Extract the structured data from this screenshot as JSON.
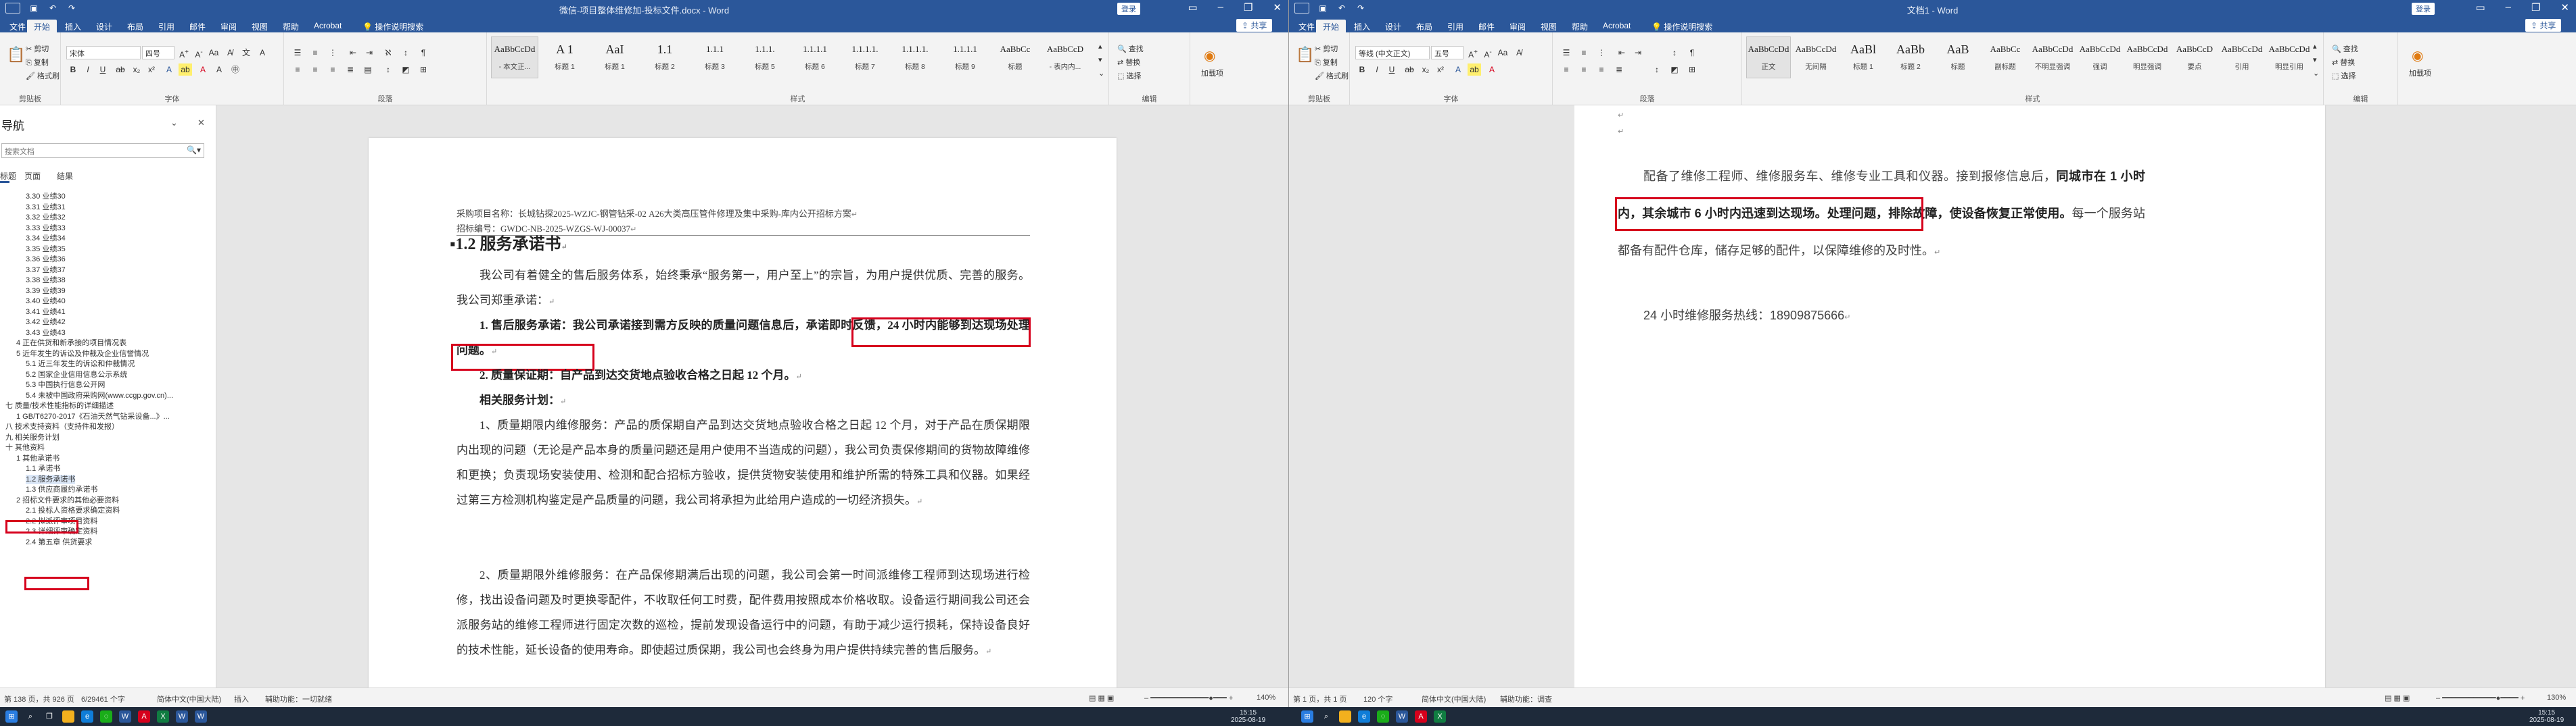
{
  "window_left": {
    "title": "微信-项目整体维修加-投标文件.docx - Word",
    "login": "登录",
    "ribbon_tabs": [
      "文件",
      "开始",
      "插入",
      "设计",
      "布局",
      "引用",
      "邮件",
      "审阅",
      "视图",
      "帮助",
      "Acrobat",
      "操作说明搜索"
    ],
    "share": "共享",
    "clipboard": {
      "cut": "剪切",
      "copy": "复制",
      "format_painter": "格式刷",
      "label": "剪贴板"
    },
    "font": {
      "name": "宋体",
      "size": "四号",
      "label": "字体"
    },
    "paragraph_label": "段落",
    "styles": [
      {
        "preview": "AaBbCcDd",
        "name": "- 本文正..."
      },
      {
        "preview": "A 1",
        "name": "标题 1"
      },
      {
        "preview": "AaI",
        "name": "标题 1"
      },
      {
        "preview": "1.1",
        "name": "标题 2"
      },
      {
        "preview": "1.1.1",
        "name": "标题 3"
      },
      {
        "preview": "1.1.1.",
        "name": "标题 5"
      },
      {
        "preview": "1.1.1.1",
        "name": "标题 6"
      },
      {
        "preview": "1.1.1.1.",
        "name": "标题 7"
      },
      {
        "preview": "1.1.1.1.",
        "name": "标题 8"
      },
      {
        "preview": "1.1.1.1",
        "name": "标题 9"
      },
      {
        "preview": "AaBbCc",
        "name": "标题"
      },
      {
        "preview": "AaBbCcD",
        "name": "- 表内内..."
      }
    ],
    "styles_label": "样式",
    "editing": {
      "find": "查找",
      "replace": "替换",
      "select": "选择",
      "label": "编辑"
    },
    "addin": "加载项",
    "nav": {
      "title": "导航",
      "search_placeholder": "搜索文档",
      "tabs": [
        "标题",
        "页面",
        "结果"
      ],
      "items": [
        "3.30 业绩30",
        "3.31 业绩31",
        "3.32 业绩32",
        "3.33 业绩33",
        "3.34 业绩34",
        "3.35 业绩35",
        "3.36 业绩36",
        "3.37 业绩37",
        "3.38 业绩38",
        "3.39 业绩39",
        "3.40 业绩40",
        "3.41 业绩41",
        "3.42 业绩42",
        "3.43 业绩43",
        "4 正在供货和新承接的项目情况表",
        "5 近年发生的诉讼及仲裁及企业信誉情况",
        "5.1 近三年发生的诉讼和仲裁情况",
        "5.2 国家企业信用信息公示系统",
        "5.3 中国执行信息公开网",
        "5.4 未被中国政府采购网(www.ccgp.gov.cn)...",
        "七 质量/技术性能指标的详细描述",
        "1 GB/T6270-2017《石油天然气钻采设备...》...",
        "八 技术支持资料（支持件和发报）",
        "九 相关服务计划",
        "十 其他资料",
        "1 其他承诺书",
        "1.1 承诺书",
        "1.2 服务承诺书",
        "1.3 供应商履约承诺书",
        "2 招标文件要求的其他必要资料",
        "2.1 投标人资格要求确定资料",
        "2.2 拟派评审项目资料",
        "2.3 详细评审确定资料",
        "2.4 第五章 供货要求"
      ]
    },
    "page": {
      "header_line1": "采购项目名称：长城钻探2025-WZJC-钢管钻采-02 A26大类高压管件修理及集中采购-库内公开招标方案",
      "header_line2": "招标编号：GWDC-NB-2025-WZGS-WJ-00037",
      "heading": "1.2 服务承诺书",
      "intro": "我公司有着健全的售后服务体系，始终秉承“服务第一，用户至上”的宗旨，为用户提供优质、完善的服务。我公司郑重承诺：",
      "item1_label": "1. 售后服务承诺：",
      "item1_text": "我公司承诺接到需方反映的质量问题信息后，",
      "item1_boxed": "承诺即时反馈，24 小时内能够到达现场处理问题。",
      "item2": "2. 质量保证期：自产品到达交货地点验收合格之日起 12 个月。",
      "related": "相关服务计划：",
      "p1": "1、质量期限内维修服务：产品的质保期自产品到达交货地点验收合格之日起 12 个月，对于产品在质保期限内出现的问题（无论是产品本身的质量问题还是用户使用不当造成的问题），我公司负责保修期间的货物故障维修和更换；负责现场安装使用、检测和配合招标方验收，提供货物安装使用和维护所需的特殊工具和仪器。如果经过第三方检测机构鉴定是产品质量的问题，我公司将承担为此给用户造成的一切经济损失。",
      "p2": "2、质量期限外维修服务：在产品保修期满后出现的问题，我公司会第一时间派维修工程师到达现场进行检修，找出设备问题及时更换零配件，不收取任何工时费，配件费用按照成本价格收取。设备运行期间我公司还会派服务站的维修工程师进行固定次数的巡检，提前发现设备运行中的问题，有助于减少运行损耗，保持设备良好的技术性能，延长设备的使用寿命。即使超过质保期，我公司也会终身为用户提供持续完善的售后服务。"
    },
    "status": {
      "page": "第 138 页，共 926 页",
      "words": "6/29461 个字",
      "lang": "简体中文(中国大陆)",
      "insert": "插入",
      "accessibility": "辅助功能：一切就绪"
    }
  },
  "window_right": {
    "title": "文档1 - Word",
    "login": "登录",
    "ribbon_tabs": [
      "文件",
      "开始",
      "插入",
      "设计",
      "布局",
      "引用",
      "邮件",
      "审阅",
      "视图",
      "帮助",
      "Acrobat",
      "操作说明搜索"
    ],
    "share": "共享",
    "clipboard": {
      "cut": "剪切",
      "copy": "复制",
      "format_painter": "格式刷",
      "label": "剪贴板"
    },
    "font": {
      "name": "等线 (中文正文)",
      "size": "五号",
      "label": "字体"
    },
    "paragraph_label": "段落",
    "styles": [
      {
        "preview": "AaBbCcDd",
        "name": "正文"
      },
      {
        "preview": "AaBbCcDd",
        "name": "无间隔"
      },
      {
        "preview": "AaBl",
        "name": "标题 1"
      },
      {
        "preview": "AaBb",
        "name": "标题 2"
      },
      {
        "preview": "AaB",
        "name": "标题"
      },
      {
        "preview": "AaBbCc",
        "name": "副标题"
      },
      {
        "preview": "AaBbCcDd",
        "name": "不明显强调"
      },
      {
        "preview": "AaBbCcDd",
        "name": "强调"
      },
      {
        "preview": "AaBbCcDd",
        "name": "明显强调"
      },
      {
        "preview": "AaBbCcD",
        "name": "要点"
      },
      {
        "preview": "AaBbCcDd",
        "name": "引用"
      },
      {
        "preview": "AaBbCcDd",
        "name": "明显引用"
      }
    ],
    "styles_label": "样式",
    "editing": {
      "find": "查找",
      "replace": "替换",
      "select": "选择",
      "label": "编辑"
    },
    "addin": "加载项",
    "page": {
      "p_intro": "配备了维修工程师、维修服务车、维修专业工具和仪器。接到报修信息后，",
      "p_boxed": "同城市在 1 小时内，其余城市 6 小时内迅速到达现场。",
      "p_bold_rest": "处理问题，排除故障，使设备恢复正常使用。",
      "p_tail": "每一个服务站都备有配件仓库，储存足够的配件，以保障维修的及时性。",
      "hotline": "24 小时维修服务热线：18909875666"
    },
    "status": {
      "page": "第 1 页，共 1 页",
      "words": "120 个字",
      "lang": "简体中文(中国大陆)",
      "accessibility": "辅助功能：调查",
      "zoom": "130%"
    }
  },
  "status_left_zoom": "140%",
  "taskbar": {
    "time": "15:15",
    "date": "2025-08-19",
    "time_right": "15:15",
    "date_right": "2025-08-19"
  }
}
